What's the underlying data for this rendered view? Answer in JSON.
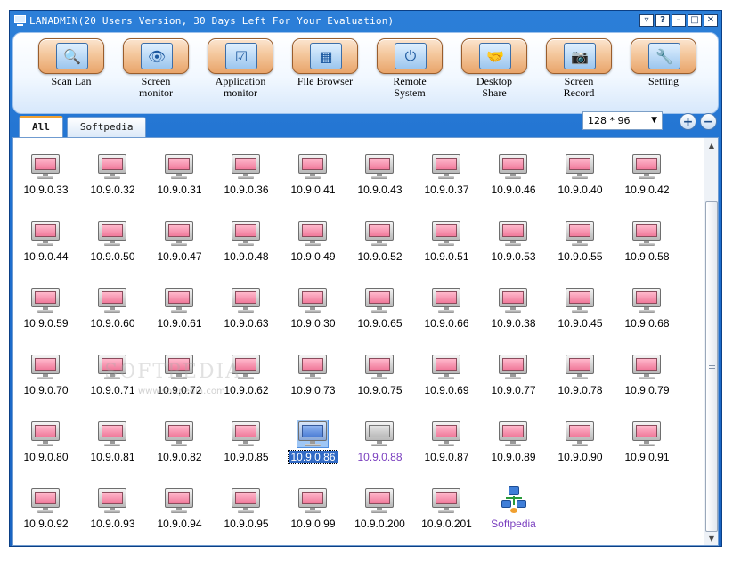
{
  "window": {
    "title": "LANADMIN(20 Users Version, 30 Days Left For Your Evaluation)",
    "controls": [
      "▿",
      "?",
      "–",
      "□",
      "✕"
    ]
  },
  "toolbar": {
    "items": [
      {
        "label": "Scan Lan",
        "icon": "🔍"
      },
      {
        "label": "Screen\nmonitor",
        "icon": "👁"
      },
      {
        "label": "Application\nmonitor",
        "icon": "☑"
      },
      {
        "label": "File Browser",
        "icon": "▦"
      },
      {
        "label": "Remote\nSystem",
        "icon": "⏻"
      },
      {
        "label": "Desktop\nShare",
        "icon": "🤝"
      },
      {
        "label": "Screen\nRecord",
        "icon": "📷"
      },
      {
        "label": "Setting",
        "icon": "🔧"
      }
    ]
  },
  "tabs": [
    {
      "label": "All",
      "active": true
    },
    {
      "label": "Softpedia",
      "active": false
    }
  ],
  "view": {
    "size_value": "128 * 96",
    "zoom_in": "+",
    "zoom_out": "−"
  },
  "hosts": [
    [
      "10.9.0.33",
      "10.9.0.32",
      "10.9.0.31",
      "10.9.0.36",
      "10.9.0.41",
      "10.9.0.43",
      "10.9.0.37",
      "10.9.0.46",
      "10.9.0.40",
      "10.9.0.42"
    ],
    [
      "10.9.0.44",
      "10.9.0.50",
      "10.9.0.47",
      "10.9.0.48",
      "10.9.0.49",
      "10.9.0.52",
      "10.9.0.51",
      "10.9.0.53",
      "10.9.0.55",
      "10.9.0.58"
    ],
    [
      "10.9.0.59",
      "10.9.0.60",
      "10.9.0.61",
      "10.9.0.63",
      "10.9.0.30",
      "10.9.0.65",
      "10.9.0.66",
      "10.9.0.38",
      "10.9.0.45",
      "10.9.0.68"
    ],
    [
      "10.9.0.70",
      "10.9.0.71",
      "10.9.0.72",
      "10.9.0.62",
      "10.9.0.73",
      "10.9.0.75",
      "10.9.0.69",
      "10.9.0.77",
      "10.9.0.78",
      "10.9.0.79"
    ],
    [
      "10.9.0.80",
      "10.9.0.81",
      "10.9.0.82",
      "10.9.0.85",
      "10.9.0.86",
      "10.9.0.88",
      "10.9.0.87",
      "10.9.0.89",
      "10.9.0.90",
      "10.9.0.91"
    ],
    [
      "10.9.0.92",
      "10.9.0.93",
      "10.9.0.94",
      "10.9.0.95",
      "10.9.0.99",
      "10.9.0.200",
      "10.9.0.201",
      "Softpedia"
    ]
  ],
  "selected_host": "10.9.0.86",
  "offline_hosts": [
    "10.9.0.88"
  ],
  "group_items": [
    "Softpedia"
  ],
  "watermark": {
    "main": "SOFTPEDIA",
    "sub": "www.softpedia.com"
  },
  "scrollbar": {
    "up": "▲",
    "down": "▼"
  }
}
